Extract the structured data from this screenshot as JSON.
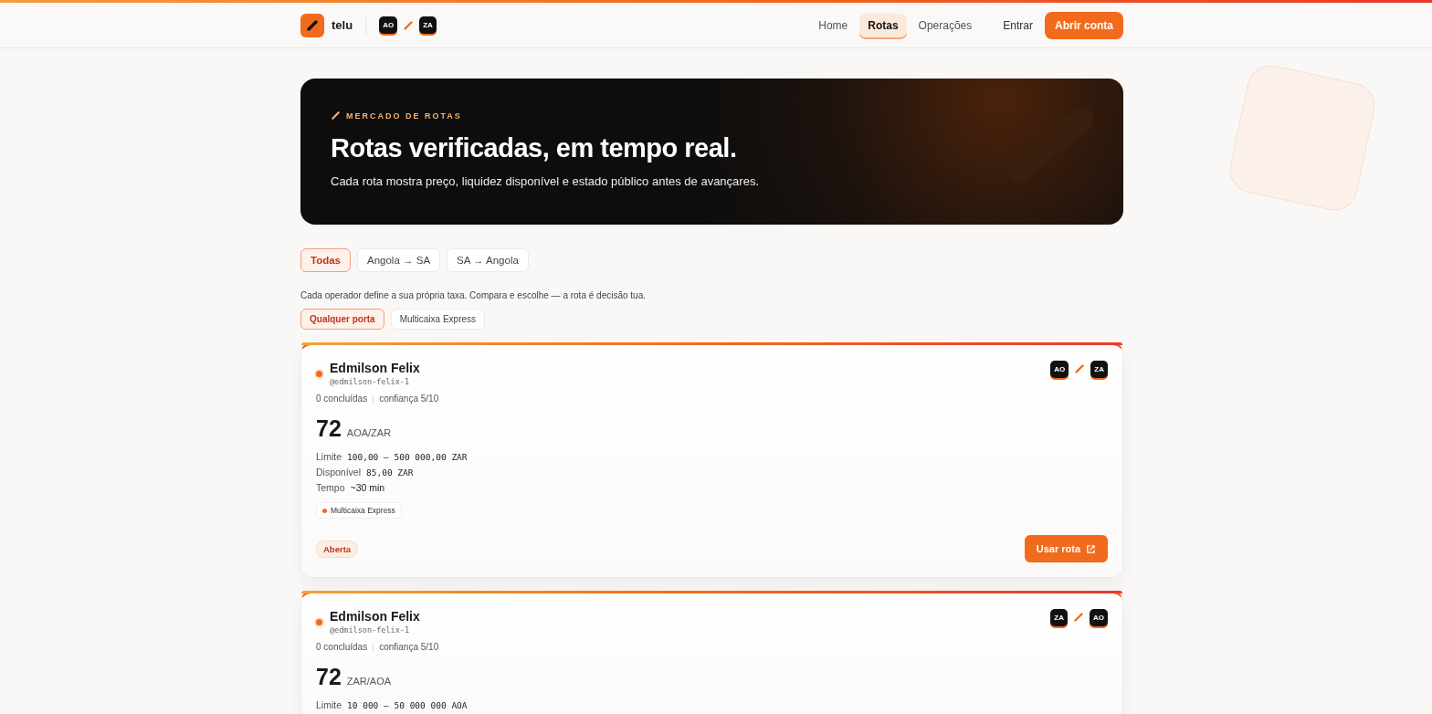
{
  "header": {
    "brand": "telu",
    "pair": {
      "from": "AO",
      "to": "ZA"
    },
    "nav": [
      {
        "label": "Home",
        "selected": false
      },
      {
        "label": "Rotas",
        "selected": true
      },
      {
        "label": "Operações",
        "selected": false
      }
    ],
    "login": "Entrar",
    "signup": "Abrir conta"
  },
  "hero": {
    "eyebrow": "MERCADO DE ROTAS",
    "title": "Rotas verificadas, em tempo real.",
    "subtitle": "Cada rota mostra preço, liquidez disponível e estado público antes de avançares."
  },
  "direction_tabs": [
    {
      "label": "Todas",
      "selected": true
    },
    {
      "label": "Angola → SA",
      "selected": false
    },
    {
      "label": "SA → Angola",
      "selected": false
    }
  ],
  "note": "Cada operador define a sua própria taxa. Compara e escolhe — a rota é decisão tua.",
  "port_filters": [
    {
      "label": "Qualquer porta",
      "selected": true
    },
    {
      "label": "Multicaixa Express",
      "selected": false
    }
  ],
  "routes": [
    {
      "name": "Edmilson Felix",
      "handle": "@edmilson-felix-1",
      "from": "AO",
      "to": "ZA",
      "completed": "0 concluídas",
      "trust": "confiança 5/10",
      "price": "72",
      "unit": "AOA/ZAR",
      "details": [
        {
          "label": "Limite",
          "value": "100,00 – 500 000,00 ZAR",
          "mono": true
        },
        {
          "label": "Disponível",
          "value": "85,00 ZAR",
          "mono": true
        },
        {
          "label": "Tempo",
          "value": "~30 min",
          "mono": false
        }
      ],
      "ports": [
        "Multicaixa Express"
      ],
      "status": "Aberta",
      "action": "Usar rota"
    },
    {
      "name": "Edmilson Felix",
      "handle": "@edmilson-felix-1",
      "from": "ZA",
      "to": "AO",
      "completed": "0 concluídas",
      "trust": "confiança 5/10",
      "price": "72",
      "unit": "ZAR/AOA",
      "details": [
        {
          "label": "Limite",
          "value": "10 000 – 50 000 000 AOA",
          "mono": true
        }
      ]
    }
  ]
}
